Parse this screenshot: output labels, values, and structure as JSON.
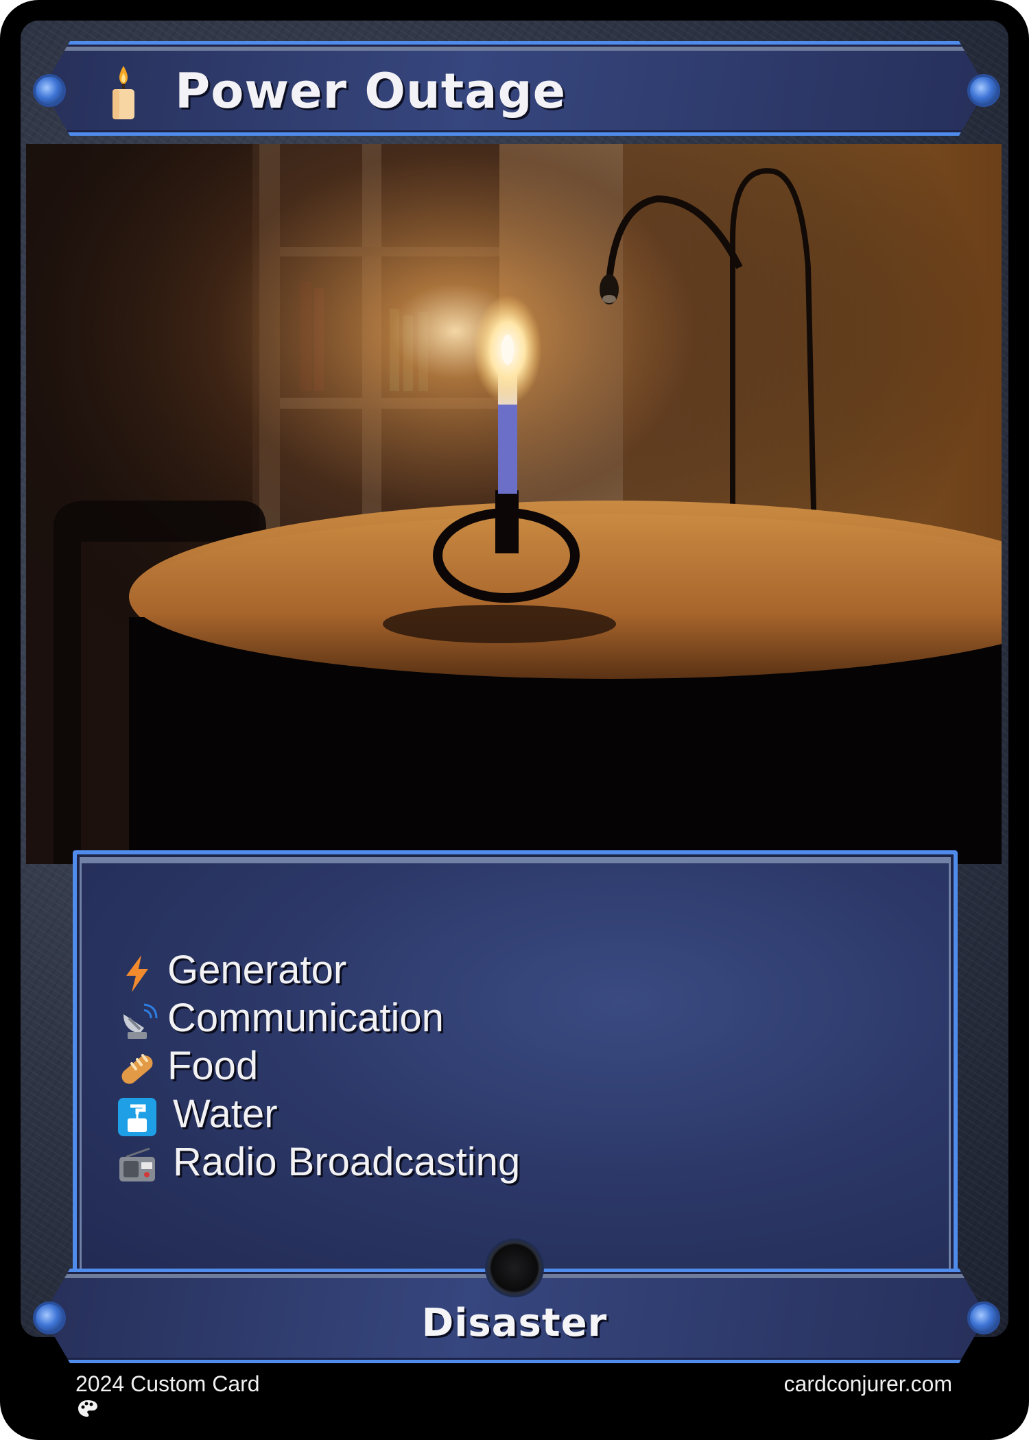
{
  "card": {
    "title": "Power Outage",
    "title_icon": "candle-icon",
    "type_line": "Disaster",
    "rules": [
      {
        "icon": "lightning-icon",
        "text": "Generator"
      },
      {
        "icon": "satellite-dish-icon",
        "text": "Communication"
      },
      {
        "icon": "bread-icon",
        "text": "Food"
      },
      {
        "icon": "water-tap-icon",
        "text": "Water"
      },
      {
        "icon": "radio-icon",
        "text": "Radio Broadcasting"
      }
    ],
    "art_description_icon": "candle-on-table-illustration"
  },
  "footer": {
    "left": "2024 Custom Card",
    "right": "cardconjurer.com",
    "artist_icon": "palette-icon"
  },
  "colors": {
    "frame_blue": "#4f8cec",
    "panel_navy": "#2c3868",
    "text": "#f3f2f6"
  }
}
